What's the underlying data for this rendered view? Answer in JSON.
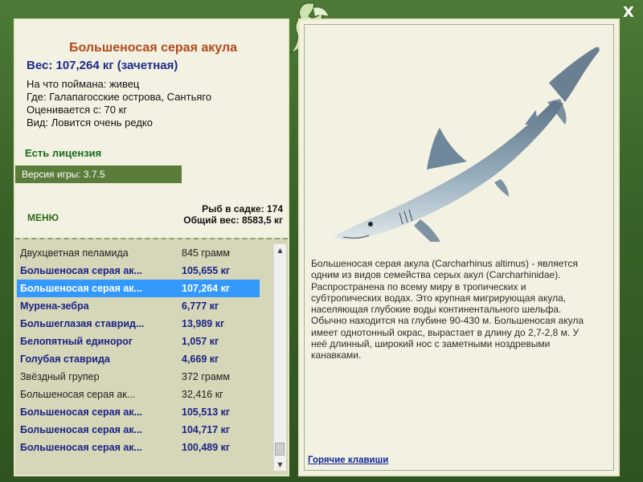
{
  "window": {
    "close_label": "X"
  },
  "fish": {
    "title": "Большеносая серая акула",
    "weight_line": "Вес: 107,264 кг (зачетная)",
    "bait": "На что поймана: живец",
    "location": "Где: Галапагосские острова, Сантьяго",
    "value": "Оценивается с: 70 кг",
    "rarity": "Вид: Ловится очень редко",
    "description": "Большеносая серая акула (Carcharhinus altimus) - является одним из видов семейства серых акул (Carcharhinidae). Распространена по всему миру в тропических и субтропических водах. Это крупная мигрирующая акула, населяющая глубокие воды континентального шельфа. Обычно находится на глубине 90-430 м. Большеносая акула имеет однотонный окрас, вырастает в длину до 2,7-2,8 м. У неё длинный, широкий нос с заметными ноздревыми канавками."
  },
  "license_text": "Есть лицензия",
  "version_text": "Версия игры: 3.7.5",
  "menu_label": "МЕНЮ",
  "stats": {
    "cage_count": "Рыб в садке: 174",
    "total_weight": "Общий вес: 8583,5 кг"
  },
  "catch_list": [
    {
      "name": "Двухцветная пеламида",
      "weight": "845 грамм",
      "bold": false,
      "selected": false
    },
    {
      "name": "Большеносая серая ак...",
      "weight": "105,655 кг",
      "bold": true,
      "selected": false
    },
    {
      "name": "Большеносая серая ак...",
      "weight": "107,264 кг",
      "bold": true,
      "selected": true
    },
    {
      "name": "Мурена-зебра",
      "weight": "6,777 кг",
      "bold": true,
      "selected": false
    },
    {
      "name": "Большеглазая ставрид...",
      "weight": "13,989 кг",
      "bold": true,
      "selected": false
    },
    {
      "name": "Белопятный единорог",
      "weight": "1,057 кг",
      "bold": true,
      "selected": false
    },
    {
      "name": "Голубая ставрида",
      "weight": "4,669 кг",
      "bold": true,
      "selected": false
    },
    {
      "name": "Звёздный групер",
      "weight": "372 грамм",
      "bold": false,
      "selected": false
    },
    {
      "name": "Большеносая серая ак...",
      "weight": "32,416 кг",
      "bold": false,
      "selected": false
    },
    {
      "name": "Большеносая серая ак...",
      "weight": "105,513 кг",
      "bold": true,
      "selected": false
    },
    {
      "name": "Большеносая серая ак...",
      "weight": "104,717 кг",
      "bold": true,
      "selected": false
    },
    {
      "name": "Большеносая серая ак...",
      "weight": "100,489 кг",
      "bold": true,
      "selected": false
    }
  ],
  "hotkeys_label": "Горячие клавиши",
  "colors": {
    "frame_green": "#3f6a2c",
    "panel_bg": "#f3f2e2",
    "title_orange": "#b4481c",
    "weight_blue": "#1d2a8a",
    "selection_blue": "#3399ff"
  }
}
